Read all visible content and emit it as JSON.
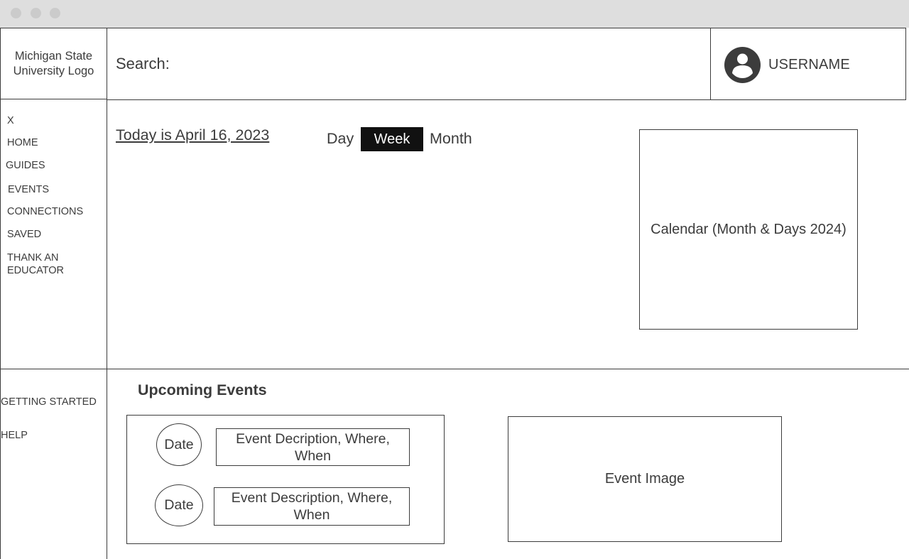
{
  "header": {
    "logo_text": "Michigan State University Logo",
    "search_label": "Search:",
    "username": "USERNAME"
  },
  "sidebar": {
    "close": "X",
    "items": [
      {
        "label": "HOME"
      },
      {
        "label": "GUIDES"
      },
      {
        "label": "EVENTS"
      },
      {
        "label": "CONNECTIONS"
      },
      {
        "label": "SAVED"
      },
      {
        "label": "THANK AN EDUCATOR"
      }
    ],
    "bottom_items": [
      {
        "label": "GETTING STARTED"
      },
      {
        "label": "HELP"
      }
    ]
  },
  "main": {
    "today_text": "Today is April 16, 2023",
    "view_tabs": [
      {
        "label": "Day"
      },
      {
        "label": "Week"
      },
      {
        "label": "Month"
      }
    ],
    "active_view": "Week",
    "calendar_placeholder": "Calendar (Month & Days 2024)"
  },
  "upcoming": {
    "title": "Upcoming Events",
    "events": [
      {
        "date": "Date",
        "description": "Event Decription, Where, When"
      },
      {
        "date": "Date",
        "description": "Event Description, Where, When"
      }
    ],
    "image_placeholder": "Event Image"
  },
  "colors": {
    "line": "#3c3c3c",
    "active_tab_bg": "#111111",
    "active_tab_text": "#ffffff",
    "titlebar": "#dedede"
  },
  "icons": {
    "avatar": "user-avatar-icon"
  }
}
